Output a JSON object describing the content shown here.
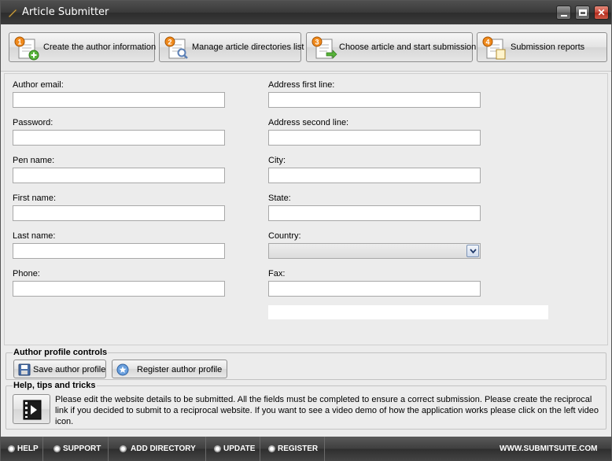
{
  "window": {
    "title": "Article Submitter"
  },
  "toolbar": {
    "steps": [
      {
        "number": "1",
        "label": "Create the author information"
      },
      {
        "number": "2",
        "label": "Manage article directories list"
      },
      {
        "number": "3",
        "label": "Choose article and start submission"
      },
      {
        "number": "4",
        "label": "Submission reports"
      }
    ]
  },
  "form": {
    "left": [
      {
        "label": "Author email:",
        "value": ""
      },
      {
        "label": "Password:",
        "value": ""
      },
      {
        "label": "Pen name:",
        "value": ""
      },
      {
        "label": "First name:",
        "value": ""
      },
      {
        "label": "Last name:",
        "value": ""
      },
      {
        "label": "Phone:",
        "value": ""
      }
    ],
    "right": [
      {
        "label": "Address first line:",
        "value": ""
      },
      {
        "label": "Address second line:",
        "value": ""
      },
      {
        "label": "City:",
        "value": ""
      },
      {
        "label": "State:",
        "value": ""
      },
      {
        "label": "Country:",
        "value": ""
      },
      {
        "label": "Fax:",
        "value": ""
      }
    ]
  },
  "controls": {
    "title": "Author profile controls",
    "save_label": "Save author profile",
    "register_label": "Register author profile"
  },
  "help": {
    "title": "Help, tips and tricks",
    "text": "Please edit the website details to be submitted. All the fields must be completed to ensure a correct submission. Please create the reciprocal link if you decided to submit to a reciprocal website. If you want to see a video demo of how the application works please click on the left video icon."
  },
  "bottombar": {
    "items": [
      "HELP",
      "SUPPORT",
      "ADD DIRECTORY",
      "UPDATE",
      "REGISTER"
    ],
    "site": "WWW.SUBMITSUITE.COM"
  },
  "colors": {
    "accent_orange": "#f08a1c",
    "title_bar": "#3a3a3a",
    "close_red": "#c8483a"
  }
}
